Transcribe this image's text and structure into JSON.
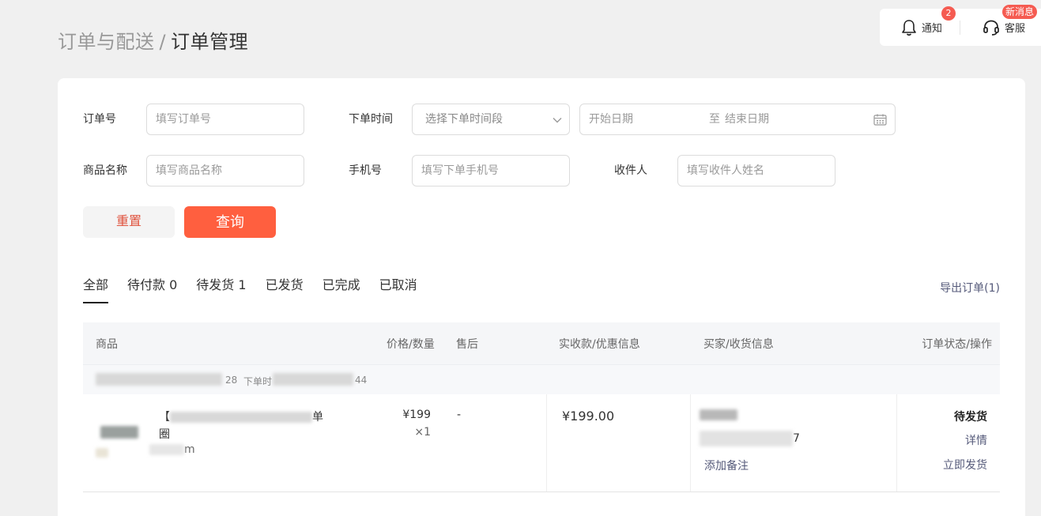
{
  "breadcrumb": {
    "parent": "订单与配送",
    "separator": "/",
    "current": "订单管理"
  },
  "topbar": {
    "notify": {
      "label": "通知",
      "count": "2",
      "icon": "bell-icon"
    },
    "service": {
      "label": "客服",
      "badge": "新消息",
      "icon": "headset-icon"
    }
  },
  "filters": {
    "order_no": {
      "label": "订单号",
      "placeholder": "填写订单号"
    },
    "order_time": {
      "label": "下单时间",
      "select_placeholder": "选择下单时间段",
      "start_placeholder": "开始日期",
      "to": "至",
      "end_placeholder": "结束日期"
    },
    "product_name": {
      "label": "商品名称",
      "placeholder": "填写商品名称"
    },
    "phone": {
      "label": "手机号",
      "placeholder": "填写下单手机号"
    },
    "receiver": {
      "label": "收件人",
      "placeholder": "填写收件人姓名"
    }
  },
  "buttons": {
    "reset": "重置",
    "search": "查询"
  },
  "tabs": [
    {
      "label": "全部",
      "active": true
    },
    {
      "label": "待付款 0"
    },
    {
      "label": "待发货 1"
    },
    {
      "label": "已发货"
    },
    {
      "label": "已完成"
    },
    {
      "label": "已取消"
    }
  ],
  "export_label": "导出订单(1)",
  "table": {
    "headers": [
      "商品",
      "价格/数量",
      "售后",
      "实收款/优惠信息",
      "买家/收货信息",
      "订单状态/操作"
    ],
    "orders": [
      {
        "order_no_suffix": "28",
        "time_label": "下单时",
        "time_suffix": "44",
        "product_title_prefix": "【",
        "product_title_suffix": "单",
        "product_title_line2": "圈",
        "product_spec_suffix": "m",
        "price": "¥199",
        "quantity": "×1",
        "after_sale": "-",
        "paid": "¥199.00",
        "buyer_phone_suffix": "7",
        "add_note": "添加备注",
        "status": "待发货",
        "detail": "详情",
        "ship_now": "立即发货"
      }
    ]
  }
}
